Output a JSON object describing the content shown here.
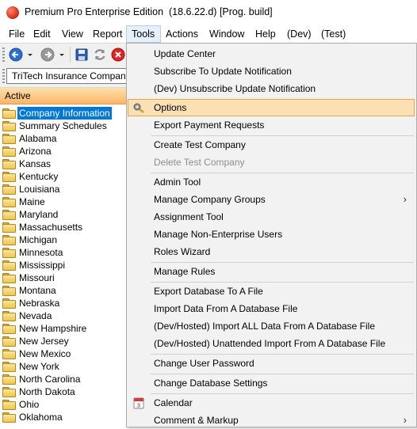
{
  "window": {
    "title": "Premium Pro Enterprise Edition  (18.6.22.d) [Prog. build]"
  },
  "menubar": {
    "items": [
      {
        "label": "File"
      },
      {
        "label": "Edit"
      },
      {
        "label": "View"
      },
      {
        "label": "Report"
      },
      {
        "label": "Tools",
        "active": true
      },
      {
        "label": "Actions"
      },
      {
        "label": "Window"
      },
      {
        "label": "Help"
      },
      {
        "label": "(Dev)"
      },
      {
        "label": "(Test)"
      }
    ]
  },
  "toolbar": {
    "buttons": [
      "back-arrow-icon",
      "dropdown-arrow-icon",
      "forward-arrow-icon",
      "dropdown-arrow-icon",
      "save-icon",
      "refresh-icon",
      "stop-icon"
    ]
  },
  "company_selector": {
    "value": "TriTech Insurance Company"
  },
  "sidebar": {
    "header": "Active",
    "items": [
      {
        "label": "Company Information",
        "selected": true
      },
      {
        "label": "Summary Schedules"
      },
      {
        "label": "Alabama"
      },
      {
        "label": "Arizona"
      },
      {
        "label": "Kansas"
      },
      {
        "label": "Kentucky"
      },
      {
        "label": "Louisiana"
      },
      {
        "label": "Maine"
      },
      {
        "label": "Maryland"
      },
      {
        "label": "Massachusetts"
      },
      {
        "label": "Michigan"
      },
      {
        "label": "Minnesota"
      },
      {
        "label": "Mississippi"
      },
      {
        "label": "Missouri"
      },
      {
        "label": "Montana"
      },
      {
        "label": "Nebraska"
      },
      {
        "label": "Nevada"
      },
      {
        "label": "New Hampshire"
      },
      {
        "label": "New Jersey"
      },
      {
        "label": "New Mexico"
      },
      {
        "label": "New York"
      },
      {
        "label": "North Carolina"
      },
      {
        "label": "North Dakota"
      },
      {
        "label": "Ohio"
      },
      {
        "label": "Oklahoma"
      }
    ]
  },
  "tools_menu": {
    "items": [
      {
        "label": "Update Center"
      },
      {
        "label": "Subscribe To Update Notification"
      },
      {
        "label": "(Dev) Unsubscribe Update Notification"
      },
      {
        "label": "Options",
        "highlighted": true,
        "icon": "options-gear-icon"
      },
      {
        "label": "Export Payment Requests"
      },
      {
        "label": "Create Test Company"
      },
      {
        "label": "Delete Test Company",
        "disabled": true
      },
      {
        "label": "Admin Tool"
      },
      {
        "label": "Manage Company Groups",
        "submenu": true
      },
      {
        "label": "Assignment Tool"
      },
      {
        "label": "Manage Non-Enterprise Users"
      },
      {
        "label": "Roles Wizard"
      },
      {
        "label": "Manage Rules"
      },
      {
        "label": "Export Database To A File"
      },
      {
        "label": "Import Data From A Database File"
      },
      {
        "label": "(Dev/Hosted) Import ALL Data From A Database File"
      },
      {
        "label": "(Dev/Hosted) Unattended Import From A Database File"
      },
      {
        "label": "Change User Password"
      },
      {
        "label": "Change Database Settings"
      },
      {
        "label": "Calendar",
        "icon": "calendar-icon"
      },
      {
        "label": "Comment & Markup",
        "submenu": true
      }
    ],
    "submenu_arrow": "›"
  },
  "colors": {
    "selection": "#0078d7",
    "menu_highlight": "#fbe0b4",
    "active_header": "#f9b56a"
  }
}
